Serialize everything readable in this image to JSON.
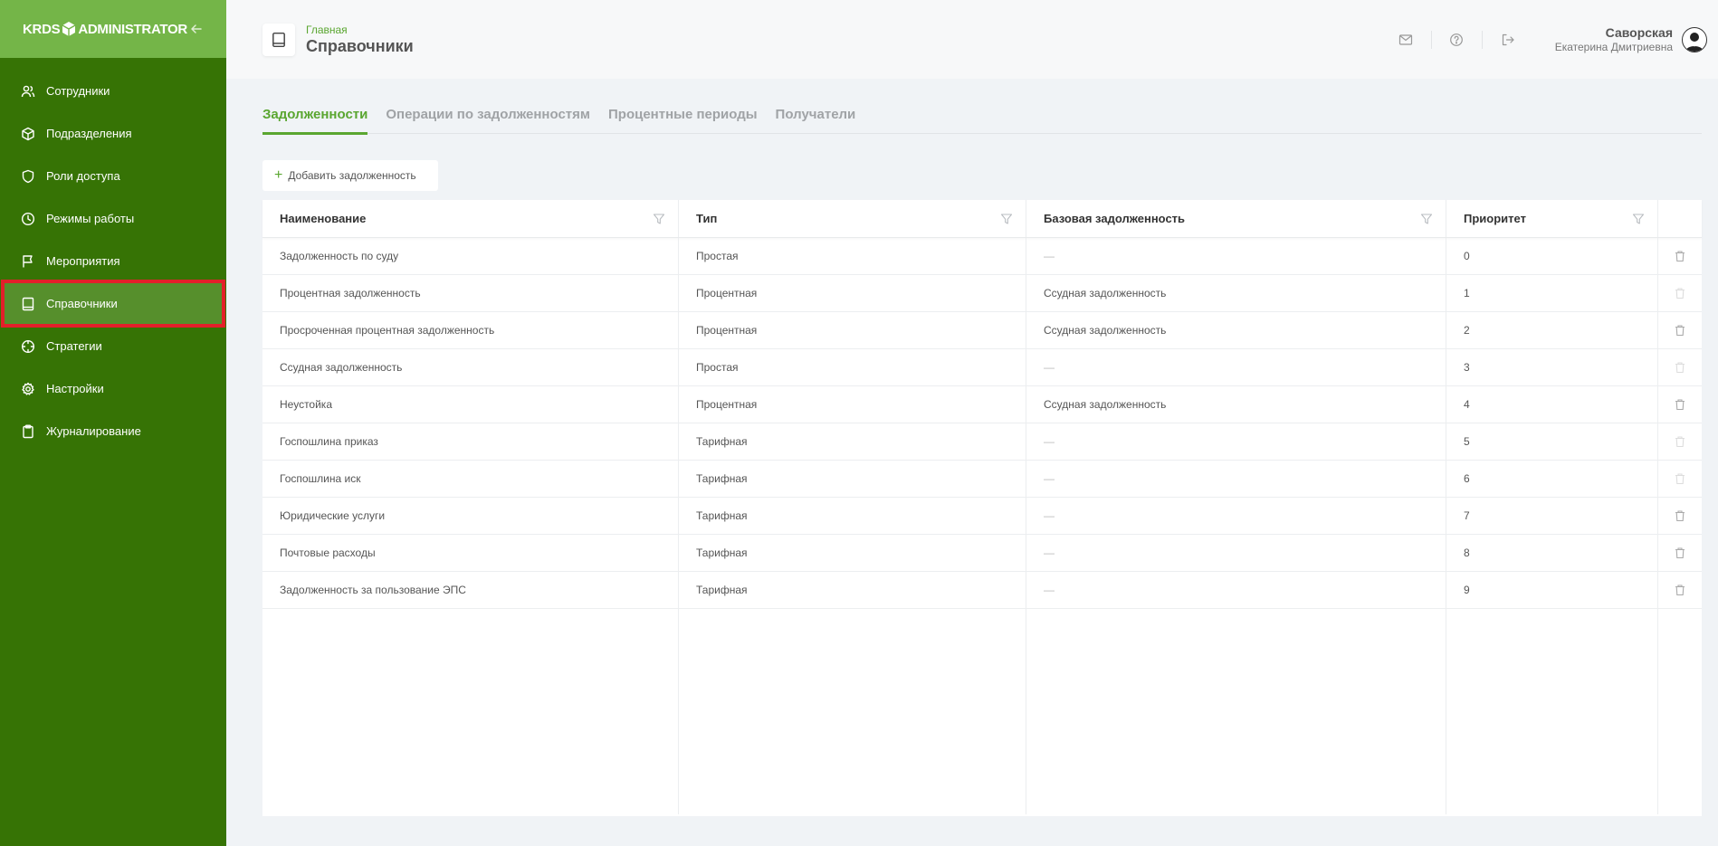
{
  "app": {
    "logo_left": "KRDS",
    "logo_right": "ADMINISTRATOR"
  },
  "sidebar": {
    "items": [
      {
        "label": "Сотрудники",
        "icon": "users-icon"
      },
      {
        "label": "Подразделения",
        "icon": "cube-icon"
      },
      {
        "label": "Роли доступа",
        "icon": "shield-icon"
      },
      {
        "label": "Режимы работы",
        "icon": "clock-icon"
      },
      {
        "label": "Мероприятия",
        "icon": "flag-icon"
      },
      {
        "label": "Справочники",
        "icon": "book-icon",
        "active": true
      },
      {
        "label": "Стратегии",
        "icon": "crosshair-icon"
      },
      {
        "label": "Настройки",
        "icon": "gear-icon"
      },
      {
        "label": "Журналирование",
        "icon": "clipboard-icon"
      }
    ]
  },
  "header": {
    "breadcrumb": "Главная",
    "title": "Справочники",
    "user_last": "Саворская",
    "user_first": "Екатерина Дмитриевна"
  },
  "tabs": [
    {
      "label": "Задолженности",
      "active": true
    },
    {
      "label": "Операции по задолженностям"
    },
    {
      "label": "Процентные периоды"
    },
    {
      "label": "Получатели"
    }
  ],
  "toolbar": {
    "add_label": "Добавить задолженность"
  },
  "table": {
    "columns": [
      "Наименование",
      "Тип",
      "Базовая задолженность",
      "Приоритет"
    ],
    "rows": [
      {
        "name": "Задолженность по суду",
        "type": "Простая",
        "base": "—",
        "priority": "0"
      },
      {
        "name": "Процентная задолженность",
        "type": "Процентная",
        "base": "Ссудная задолженность",
        "priority": "1"
      },
      {
        "name": "Просроченная процентная задолженность",
        "type": "Процентная",
        "base": "Ссудная задолженность",
        "priority": "2"
      },
      {
        "name": "Ссудная задолженность",
        "type": "Простая",
        "base": "—",
        "priority": "3"
      },
      {
        "name": "Неустойка",
        "type": "Процентная",
        "base": "Ссудная задолженность",
        "priority": "4"
      },
      {
        "name": "Госпошлина приказ",
        "type": "Тарифная",
        "base": "—",
        "priority": "5"
      },
      {
        "name": "Госпошлина иск",
        "type": "Тарифная",
        "base": "—",
        "priority": "6"
      },
      {
        "name": "Юридические услуги",
        "type": "Тарифная",
        "base": "—",
        "priority": "7"
      },
      {
        "name": "Почтовые расходы",
        "type": "Тарифная",
        "base": "—",
        "priority": "8"
      },
      {
        "name": "Задолженность за пользование ЭПС",
        "type": "Тарифная",
        "base": "—",
        "priority": "9"
      }
    ]
  },
  "colors": {
    "sidebar_bg": "#367305",
    "sidebar_header": "#74b548",
    "accent": "#5aa630",
    "highlight": "#e3202a"
  }
}
